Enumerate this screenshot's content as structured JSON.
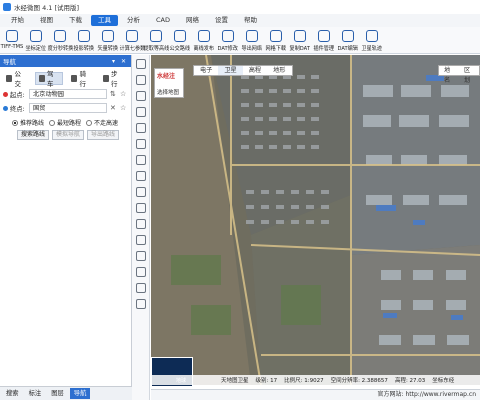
{
  "app": {
    "title": "水经微图 4.1 [试用版]"
  },
  "menu": {
    "tabs": [
      "开始",
      "视图",
      "下载",
      "工具",
      "分析",
      "CAD",
      "网络",
      "设置",
      "帮助"
    ],
    "active_index": 3
  },
  "toolbar": {
    "items": [
      "TIFF-TMS",
      "坐标定位",
      "度分秒转换",
      "投影转换",
      "矢量转换",
      "计算七参数",
      "提取等高线",
      "公交路线",
      "离线发布",
      "DAT修改",
      "导出网络",
      "网格下载",
      "复制DAT",
      "插件管理",
      "DAT编辑",
      "卫星轨迹"
    ]
  },
  "panel": {
    "title": "导航",
    "modes": [
      "公交",
      "驾车",
      "骑行",
      "步行"
    ],
    "active_mode_index": 1,
    "start_label": "起点:",
    "start_value": "北京动物园",
    "end_label": "终点:",
    "end_value": "国贸",
    "route_options": [
      "推荐路线",
      "最短路程",
      "不走高速"
    ],
    "selected_option_index": 0,
    "buttons": [
      "搜索路线",
      "模拟导航",
      "导出路线"
    ],
    "bottom_tabs": [
      "搜索",
      "标注",
      "图层",
      "导航"
    ],
    "bottom_active_index": 3
  },
  "map": {
    "type_tabs": [
      "电子",
      "卫星",
      "高程",
      "地形"
    ],
    "type_active_index": 1,
    "extra_tabs": [
      "地名",
      "区划"
    ],
    "logo_text": "水经注",
    "logo_sub": "选择地图",
    "overview_label": "地球",
    "status": {
      "source": "天地图卫星",
      "level": "级别: 17",
      "scale": "比例尺: 1:9027",
      "resolution": "空间分辨率: 2.388657",
      "elevation": "高程: 27.03",
      "coord": "坐标东经"
    },
    "footer": "官方网站: http://www.rivermap.cn"
  },
  "colors": {
    "accent": "#1e6fd9",
    "panel_header": "#2d6fd0"
  }
}
